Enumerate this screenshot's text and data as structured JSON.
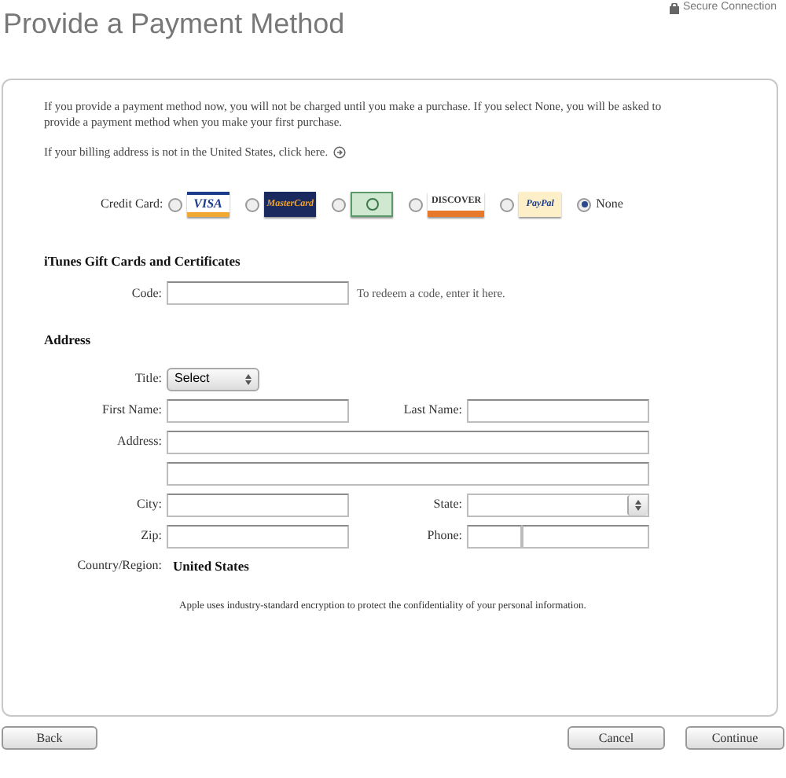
{
  "secure_connection": "Secure Connection",
  "title": "Provide a Payment Method",
  "intro": "If you provide a payment method now, you will not be charged until you make a purchase. If you select None, you will be asked to provide a payment method when you make your first purchase.",
  "billing_link": "If your billing address is not in the United States, click here.",
  "credit_card": {
    "label": "Credit Card:",
    "options": [
      {
        "kind": "visa",
        "text": "VISA",
        "selected": false
      },
      {
        "kind": "mastercard",
        "text": "MasterCard",
        "selected": false
      },
      {
        "kind": "amex",
        "selected": false
      },
      {
        "kind": "discover",
        "text": "DISCOVER",
        "selected": false
      },
      {
        "kind": "paypal",
        "text": "PayPal",
        "selected": false
      },
      {
        "kind": "none",
        "text": "None",
        "selected": true
      }
    ]
  },
  "gift": {
    "heading": "iTunes Gift Cards and Certificates",
    "code_label": "Code:",
    "hint": "To redeem a code, enter it here."
  },
  "address": {
    "heading": "Address",
    "title_label": "Title:",
    "title_value": "Select",
    "first_name": "First Name:",
    "last_name": "Last Name:",
    "address": "Address:",
    "city": "City:",
    "state": "State:",
    "zip": "Zip:",
    "phone": "Phone:",
    "country_label": "Country/Region:",
    "country_value": "United States"
  },
  "encryption_note": "Apple uses industry-standard encryption to protect the confidentiality of your personal information.",
  "buttons": {
    "back": "Back",
    "cancel": "Cancel",
    "continue": "Continue"
  }
}
